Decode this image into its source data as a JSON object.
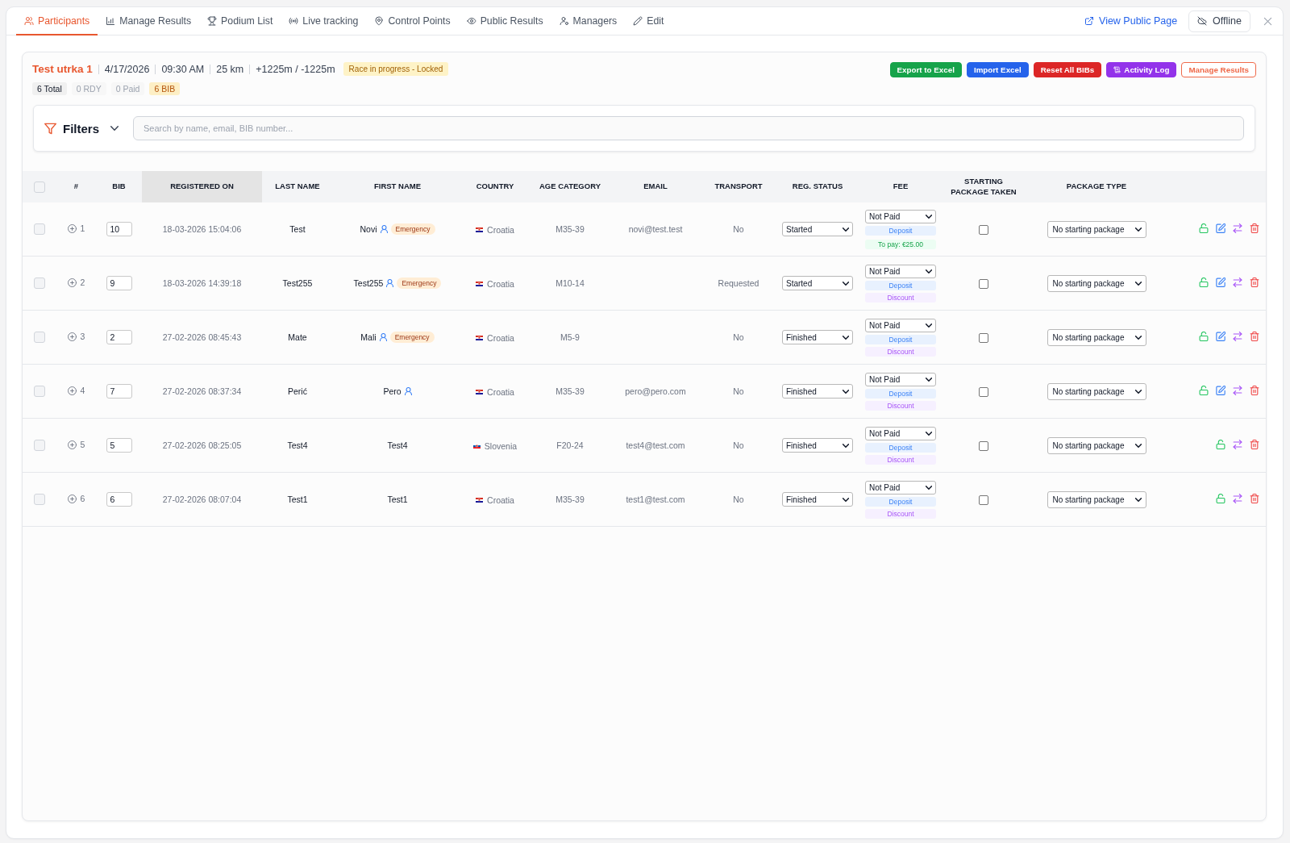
{
  "tabs": [
    {
      "label": "Participants",
      "selected": true
    },
    {
      "label": "Manage Results",
      "selected": false
    },
    {
      "label": "Podium List",
      "selected": false
    },
    {
      "label": "Live tracking",
      "selected": false
    },
    {
      "label": "Control Points",
      "selected": false
    },
    {
      "label": "Public Results",
      "selected": false
    },
    {
      "label": "Managers",
      "selected": false
    },
    {
      "label": "Edit",
      "selected": false
    }
  ],
  "top_actions": {
    "public_page_link": "View Public Page",
    "offline_button": "Offline"
  },
  "race": {
    "name": "Test utrka 1",
    "details": [
      "4/17/2026",
      "09:30 AM",
      "25 km",
      "+1225m / -1225m"
    ],
    "status": "Race in progress - Locked"
  },
  "counts": [
    {
      "label": "6 Total",
      "kind": "total"
    },
    {
      "label": "0 RDY",
      "kind": "muted"
    },
    {
      "label": "0 Paid",
      "kind": "muted"
    },
    {
      "label": "6 BIB",
      "kind": "bib"
    }
  ],
  "buttons": [
    {
      "label": "Export to Excel",
      "kind": "filled",
      "color": "#16a34a"
    },
    {
      "label": "Import Excel",
      "kind": "filled",
      "color": "#2563eb"
    },
    {
      "label": "Reset All BIBs",
      "kind": "filled",
      "color": "#dc2626"
    },
    {
      "label": "Activity Log",
      "kind": "log",
      "color": "#9333ea"
    },
    {
      "label": "Manage Results",
      "kind": "outline",
      "color": "#ef6a4a"
    }
  ],
  "filters": {
    "label": "Filters",
    "expanded": false
  },
  "search": {
    "placeholder": "Search by name, email, BIB number..."
  },
  "table": {
    "select_all_checked": false,
    "columns": [
      {
        "label": "#",
        "selected": false
      },
      {
        "label": "BIB",
        "selected": false
      },
      {
        "label": "REGISTERED ON",
        "selected": true
      },
      {
        "label": "LAST NAME",
        "selected": false
      },
      {
        "label": "FIRST NAME",
        "selected": false
      },
      {
        "label": "COUNTRY",
        "selected": false
      },
      {
        "label": "AGE CATEGORY",
        "selected": false
      },
      {
        "label": "EMAIL",
        "selected": false
      },
      {
        "label": "TRANSPORT",
        "selected": false
      },
      {
        "label": "REG. STATUS",
        "selected": false
      },
      {
        "label": "FEE",
        "selected": false
      },
      {
        "label": "STARTING PACKAGE TAKEN",
        "selected": false
      },
      {
        "label": "PACKAGE TYPE",
        "selected": false
      }
    ],
    "rows": [
      {
        "checked": false,
        "expanded": false,
        "number": "1",
        "bib": "10",
        "registered_on": "18-03-2026 15:04:06",
        "last_name": "Test",
        "first_name": "Novi",
        "linked_user": true,
        "badge": "Emergency",
        "country": {
          "name": "Croatia",
          "kind": "hr"
        },
        "age_category": "M35-39",
        "email": "novi@test.test",
        "transport": "No",
        "reg_status": "Started",
        "fee_status": "Not Paid",
        "fee_tags": [
          {
            "label": "Deposit",
            "kind": "deposit"
          },
          {
            "label": "To pay: €25.00",
            "kind": "due"
          }
        ],
        "package_taken": false,
        "package_type": "No starting package",
        "editable": true
      },
      {
        "checked": false,
        "expanded": false,
        "number": "2",
        "bib": "9",
        "registered_on": "18-03-2026 14:39:18",
        "last_name": "Test255",
        "first_name": "Test255",
        "linked_user": true,
        "badge": "Emergency",
        "country": {
          "name": "Croatia",
          "kind": "hr"
        },
        "age_category": "M10-14",
        "transport": "Requested",
        "reg_status": "Started",
        "fee_status": "Not Paid",
        "fee_tags": [
          {
            "label": "Deposit",
            "kind": "deposit"
          },
          {
            "label": "Discount",
            "kind": "discount"
          }
        ],
        "package_taken": false,
        "package_type": "No starting package",
        "editable": true
      },
      {
        "checked": false,
        "expanded": false,
        "number": "3",
        "bib": "2",
        "registered_on": "27-02-2026 08:45:43",
        "last_name": "Mate",
        "first_name": "Mali",
        "linked_user": true,
        "badge": "Emergency",
        "country": {
          "name": "Croatia",
          "kind": "hr"
        },
        "age_category": "M5-9",
        "transport": "No",
        "reg_status": "Finished",
        "fee_status": "Not Paid",
        "fee_tags": [
          {
            "label": "Deposit",
            "kind": "deposit"
          },
          {
            "label": "Discount",
            "kind": "discount"
          }
        ],
        "package_taken": false,
        "package_type": "No starting package",
        "editable": true
      },
      {
        "checked": false,
        "expanded": false,
        "number": "4",
        "bib": "7",
        "registered_on": "27-02-2026 08:37:34",
        "last_name": "Perić",
        "first_name": "Pero",
        "linked_user": true,
        "country": {
          "name": "Croatia",
          "kind": "hr"
        },
        "age_category": "M35-39",
        "email": "pero@pero.com",
        "transport": "No",
        "reg_status": "Finished",
        "fee_status": "Not Paid",
        "fee_tags": [
          {
            "label": "Deposit",
            "kind": "deposit"
          },
          {
            "label": "Discount",
            "kind": "discount"
          }
        ],
        "package_taken": false,
        "package_type": "No starting package",
        "editable": true
      },
      {
        "checked": false,
        "expanded": false,
        "number": "5",
        "bib": "5",
        "registered_on": "27-02-2026 08:25:05",
        "last_name": "Test4",
        "first_name": "Test4",
        "linked_user": false,
        "country": {
          "name": "Slovenia",
          "kind": "si"
        },
        "age_category": "F20-24",
        "email": "test4@test.com",
        "transport": "No",
        "reg_status": "Finished",
        "fee_status": "Not Paid",
        "fee_tags": [
          {
            "label": "Deposit",
            "kind": "deposit"
          },
          {
            "label": "Discount",
            "kind": "discount"
          }
        ],
        "package_taken": false,
        "package_type": "No starting package",
        "editable": false
      },
      {
        "checked": false,
        "expanded": false,
        "number": "6",
        "bib": "6",
        "registered_on": "27-02-2026 08:07:04",
        "last_name": "Test1",
        "first_name": "Test1",
        "linked_user": false,
        "country": {
          "name": "Croatia",
          "kind": "hr"
        },
        "age_category": "M35-39",
        "email": "test1@test.com",
        "transport": "No",
        "reg_status": "Finished",
        "fee_status": "Not Paid",
        "fee_tags": [
          {
            "label": "Deposit",
            "kind": "deposit"
          },
          {
            "label": "Discount",
            "kind": "discount"
          }
        ],
        "package_taken": false,
        "package_type": "No starting package",
        "editable": false
      }
    ]
  }
}
